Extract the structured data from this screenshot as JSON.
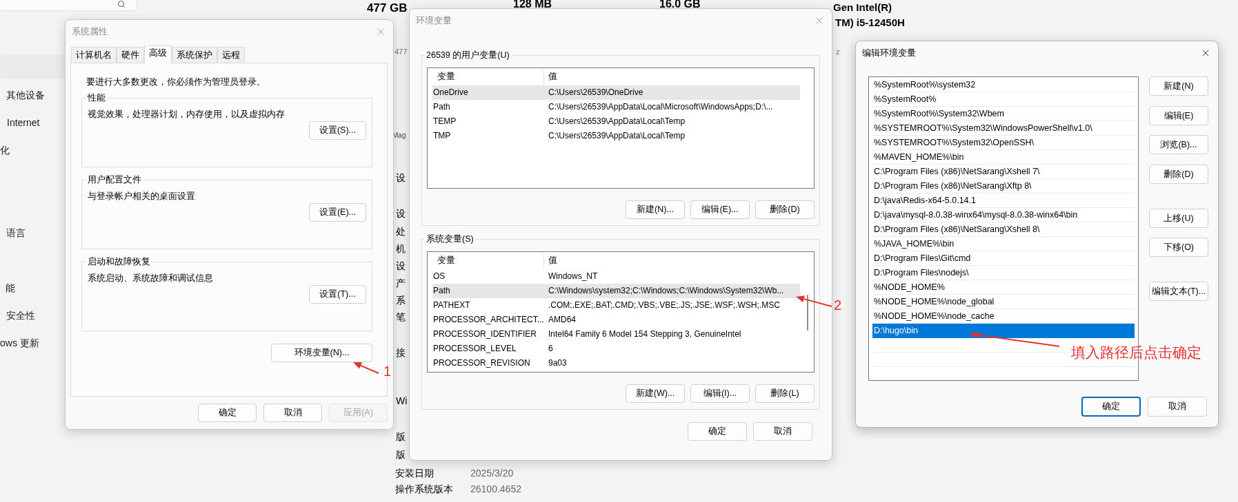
{
  "background": {
    "sidebar_items": [
      "其他设备",
      "Internet",
      "化",
      "语言",
      "能",
      "安全性",
      "ows 更新"
    ],
    "specs": [
      "477 GB",
      "128 MB",
      "16.0 GB",
      "Gen Intel(R)",
      "TM) i5-12450H"
    ],
    "fragments": [
      "477",
      "Mag",
      "设",
      "设",
      "处",
      "机",
      "设",
      "产",
      "系",
      "笔",
      "接",
      "Wi",
      "版",
      "版",
      "z"
    ],
    "details": [
      {
        "label": "安装日期",
        "value": "2025/3/20"
      },
      {
        "label": "操作系统版本",
        "value": "26100.4652"
      }
    ]
  },
  "system_properties": {
    "title": "系统属性",
    "tabs": [
      {
        "label": "计算机名",
        "selected": false
      },
      {
        "label": "硬件",
        "selected": false
      },
      {
        "label": "高级",
        "selected": true
      },
      {
        "label": "系统保护",
        "selected": false
      },
      {
        "label": "远程",
        "selected": false
      }
    ],
    "notice": "要进行大多数更改，你必须作为管理员登录。",
    "groups": [
      {
        "title": "性能",
        "description": "视觉效果，处理器计划，内存使用，以及虚拟内存",
        "button": "设置(S)..."
      },
      {
        "title": "用户配置文件",
        "description": "与登录帐户相关的桌面设置",
        "button": "设置(E)..."
      },
      {
        "title": "启动和故障恢复",
        "description": "系统启动、系统故障和调试信息",
        "button": "设置(T)..."
      }
    ],
    "env_button": "环境变量(N)...",
    "buttons": [
      {
        "label": "确定",
        "disabled": false
      },
      {
        "label": "取消",
        "disabled": false
      },
      {
        "label": "应用(A)",
        "disabled": true
      }
    ]
  },
  "environment_variables": {
    "title": "环境变量",
    "user_group": {
      "title": "26539 的用户变量(U)",
      "columns": [
        "变量",
        "值"
      ],
      "rows": [
        {
          "name": "OneDrive",
          "value": "C:\\Users\\26539\\OneDrive",
          "selected": true
        },
        {
          "name": "Path",
          "value": "C:\\Users\\26539\\AppData\\Local\\Microsoft\\WindowsApps;D:\\...",
          "selected": false
        },
        {
          "name": "TEMP",
          "value": "C:\\Users\\26539\\AppData\\Local\\Temp",
          "selected": false
        },
        {
          "name": "TMP",
          "value": "C:\\Users\\26539\\AppData\\Local\\Temp",
          "selected": false
        }
      ],
      "buttons": [
        "新建(N)...",
        "编辑(E)...",
        "删除(D)"
      ]
    },
    "system_group": {
      "title": "系统变量(S)",
      "columns": [
        "变量",
        "值"
      ],
      "rows": [
        {
          "name": "OS",
          "value": "Windows_NT",
          "selected": false
        },
        {
          "name": "Path",
          "value": "C:\\Windows\\system32;C:\\Windows;C:\\Windows\\System32\\Wb...",
          "selected": true
        },
        {
          "name": "PATHEXT",
          "value": ".COM;.EXE;.BAT;.CMD;.VBS;.VBE;.JS;.JSE;.WSF;.WSH;.MSC",
          "selected": false
        },
        {
          "name": "PROCESSOR_ARCHITECT...",
          "value": "AMD64",
          "selected": false
        },
        {
          "name": "PROCESSOR_IDENTIFIER",
          "value": "Intel64 Family 6 Model 154 Stepping 3, GenuineIntel",
          "selected": false
        },
        {
          "name": "PROCESSOR_LEVEL",
          "value": "6",
          "selected": false
        },
        {
          "name": "PROCESSOR_REVISION",
          "value": "9a03",
          "selected": false
        }
      ],
      "buttons": [
        "新建(W)...",
        "编辑(I)...",
        "删除(L)"
      ]
    },
    "buttons": [
      "确定",
      "取消"
    ]
  },
  "edit_environment_variable": {
    "title": "编辑环境变量",
    "entries": [
      {
        "text": "%SystemRoot%\\system32",
        "selected": false
      },
      {
        "text": "%SystemRoot%",
        "selected": false
      },
      {
        "text": "%SystemRoot%\\System32\\Wbem",
        "selected": false
      },
      {
        "text": "%SYSTEMROOT%\\System32\\WindowsPowerShell\\v1.0\\",
        "selected": false
      },
      {
        "text": "%SYSTEMROOT%\\System32\\OpenSSH\\",
        "selected": false
      },
      {
        "text": "%MAVEN_HOME%\\bin",
        "selected": false
      },
      {
        "text": "C:\\Program Files (x86)\\NetSarang\\Xshell 7\\",
        "selected": false
      },
      {
        "text": "D:\\Program Files (x86)\\NetSarang\\Xftp 8\\",
        "selected": false
      },
      {
        "text": "D:\\java\\Redis-x64-5.0.14.1",
        "selected": false
      },
      {
        "text": "D:\\java\\mysql-8.0.38-winx64\\mysql-8.0.38-winx64\\bin",
        "selected": false
      },
      {
        "text": "D:\\Program Files (x86)\\NetSarang\\Xshell 8\\",
        "selected": false
      },
      {
        "text": "%JAVA_HOME%\\bin",
        "selected": false
      },
      {
        "text": "D:\\Program Files\\Git\\cmd",
        "selected": false
      },
      {
        "text": "D:\\Program Files\\nodejs\\",
        "selected": false
      },
      {
        "text": "%NODE_HOME%",
        "selected": false
      },
      {
        "text": "%NODE_HOME%\\node_global",
        "selected": false
      },
      {
        "text": "%NODE_HOME%\\node_cache",
        "selected": false
      },
      {
        "text": "D:\\hugo\\bin",
        "selected": true
      }
    ],
    "side_buttons": [
      "新建(N)",
      "编辑(E)",
      "浏览(B)...",
      "删除(D)",
      "上移(U)",
      "下移(O)",
      "编辑文本(T)..."
    ],
    "buttons": [
      {
        "label": "确定",
        "default": true
      },
      {
        "label": "取消",
        "default": false
      }
    ]
  },
  "annotations": [
    "1",
    "2",
    "填入路径后点击确定"
  ]
}
